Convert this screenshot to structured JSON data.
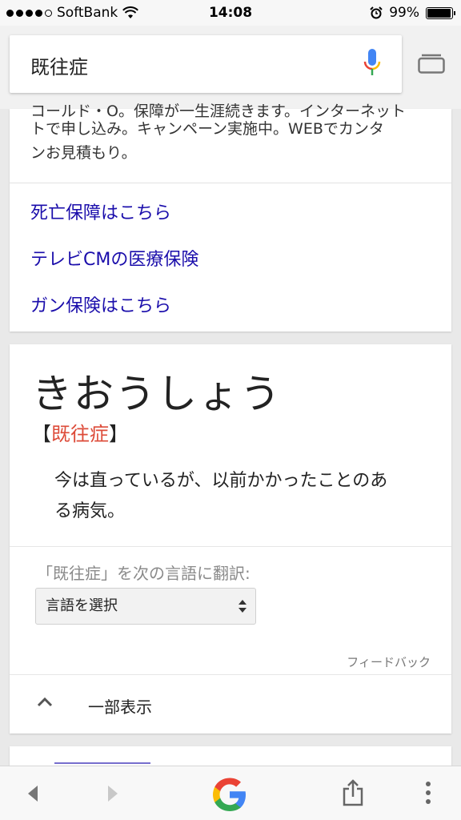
{
  "status": {
    "carrier": "SoftBank",
    "time": "14:08",
    "battery": "99%"
  },
  "search": {
    "query": "既往症"
  },
  "ad": {
    "cut_line": "コールド・O。保障が一生涯続きます。インターネット",
    "line1": "トで申し込み。キャンペーン実施中。WEBでカンタ",
    "line2": "ンお見積もり。",
    "links": [
      "死亡保障はこちら",
      "テレビCMの医療保険",
      "ガン保険はこちら"
    ]
  },
  "dictionary": {
    "reading": "きおうしょう",
    "bracket_open": "【",
    "kanji": "既往症",
    "bracket_close": "】",
    "definition_line1": "今は直っているが、以前かかったことのあ",
    "definition_line2": "る病気。",
    "translate_label": "「既往症」を次の言語に翻訳:",
    "select_value": "言語を選択",
    "feedback": "フィードバック",
    "collapse_label": "一部表示"
  },
  "colors": {
    "link": "#1a0dab",
    "kanji_accent": "#dd4b39"
  }
}
